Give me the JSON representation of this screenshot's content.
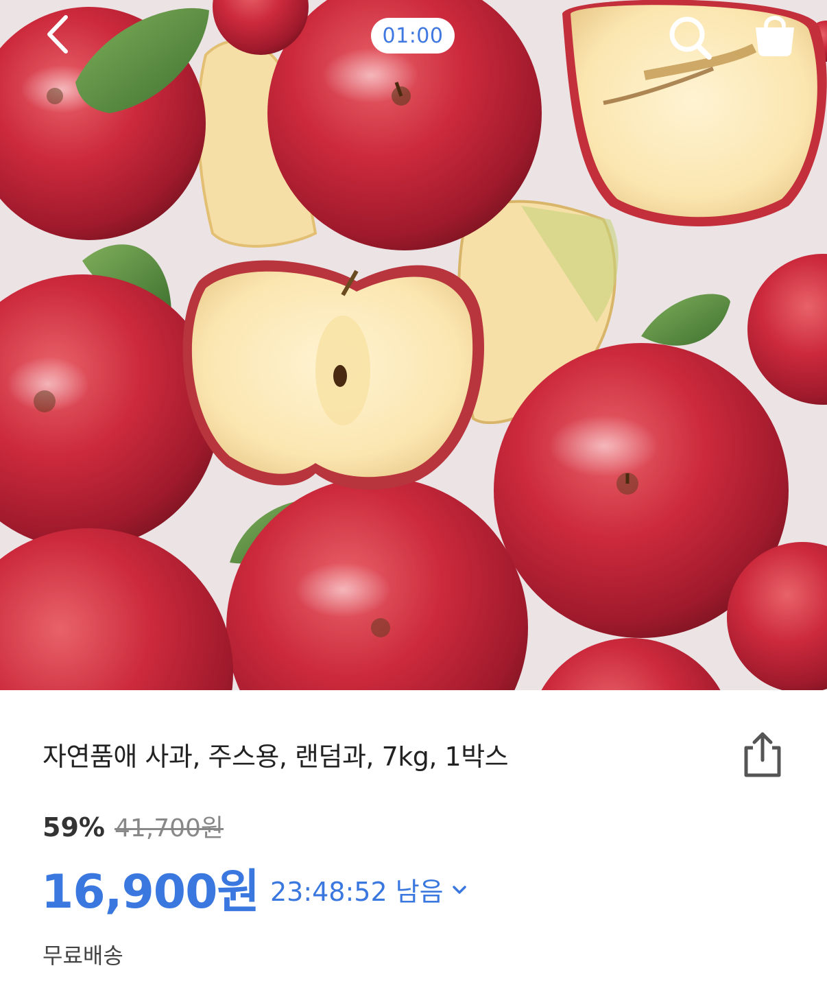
{
  "header": {
    "timer": "01:00",
    "icons": {
      "back": "chevron-left-icon",
      "search": "search-icon",
      "cart": "shopping-bag-icon"
    }
  },
  "product": {
    "title": "자연품애 사과, 주스용, 랜덤과, 7kg, 1박스",
    "discount": "59%",
    "original_price": "41,700원",
    "price": "16,900원",
    "time_left": "23:48:52 남음",
    "shipping": "무료배송",
    "share_icon": "share-icon"
  },
  "colors": {
    "accent": "#3a78e0",
    "apple_red": "#c8283a"
  }
}
